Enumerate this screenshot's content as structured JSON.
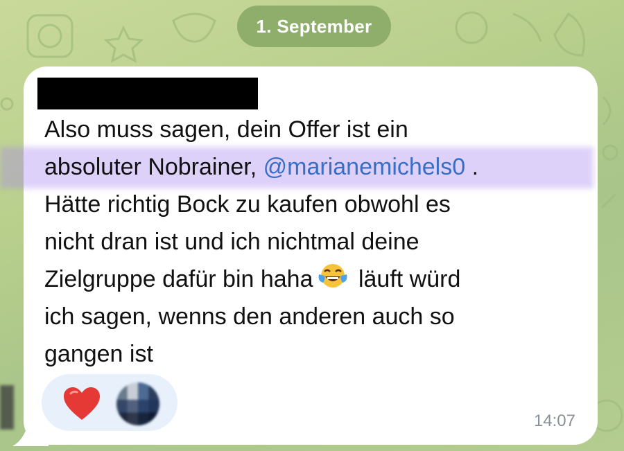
{
  "chat": {
    "date_label": "1. September",
    "message": {
      "line1": "Also muss sagen, dein Offer ist ein",
      "line2_before": "absoluter Nobrainer, ",
      "mention": "@marianemichels0",
      "line2_after": " .",
      "line3": "Hätte richtig Bock zu kaufen obwohl es",
      "line4": "nicht dran ist und ich nichtmal deine",
      "line5_before": "Zielgruppe dafür bin haha",
      "line5_after": " läuft würd",
      "line6": "ich sagen, wenns den anderen auch so",
      "line7": "gangen ist"
    },
    "time": "14:07",
    "reaction_icon": "heart-icon",
    "emoji_icon": "tears-of-joy-icon"
  },
  "colors": {
    "mention": "#3a6ec4",
    "date_pill": "#8fae6c",
    "reaction_bg": "#e7f0fb",
    "heart": "#e53935"
  }
}
